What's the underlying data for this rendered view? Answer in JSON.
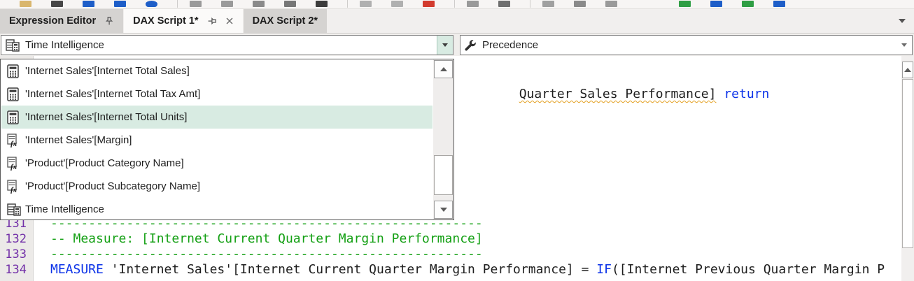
{
  "colors": {
    "keyword-blue": "#0b32e8",
    "comment-green": "#14a014",
    "line-number-purple": "#7230a8",
    "selection-mint": "#d8ebe2",
    "squiggle-orange": "#e3a021",
    "tab-active-bg": "#fbfaf9",
    "tab-inactive-bg": "#d5d3d1"
  },
  "toolbar": {
    "icons": [
      {
        "color": "#d9b66d"
      },
      {
        "color": "#474747"
      },
      {
        "color": "#1e5ec8"
      },
      {
        "color": "#1e5ec8"
      },
      {
        "color": "#1e5ec8",
        "shape": "circle"
      },
      {
        "sep": true
      },
      {
        "color": "#9a9a9a"
      },
      {
        "color": "#9a9a9a"
      },
      {
        "color": "#8a8a8a"
      },
      {
        "color": "#777777"
      },
      {
        "color": "#3c3c3c"
      },
      {
        "sep": true
      },
      {
        "color": "#b0b0b0"
      },
      {
        "color": "#b0b0b0"
      },
      {
        "color": "#d23b2e"
      },
      {
        "sep": true
      },
      {
        "color": "#9a9a9a"
      },
      {
        "color": "#6f6f6f"
      },
      {
        "sep": true
      },
      {
        "color": "#a0a0a0"
      },
      {
        "color": "#8a8a8a"
      },
      {
        "color": "#9a9a9a"
      },
      {
        "gap": 60
      },
      {
        "color": "#2f9e44"
      },
      {
        "color": "#1e5ec8"
      },
      {
        "color": "#2f9e44"
      },
      {
        "color": "#1e5ec8"
      }
    ]
  },
  "tabs": [
    {
      "label": "Expression Editor",
      "state": "inactive",
      "pinned": true
    },
    {
      "label": "DAX Script 1*",
      "state": "active",
      "pinned": false,
      "closable": true
    },
    {
      "label": "DAX Script 2*",
      "state": "inactive"
    }
  ],
  "combos": {
    "left": {
      "value": "Time Intelligence",
      "icon": "calc-table-icon"
    },
    "right": {
      "value": "Precedence",
      "icon": "wrench-icon"
    }
  },
  "dropdown": {
    "items": [
      {
        "label": "'Internet Sales'[Internet Total Sales]",
        "icon": "calculator",
        "selected": false
      },
      {
        "label": "'Internet Sales'[Internet Total Tax Amt]",
        "icon": "calculator",
        "selected": false
      },
      {
        "label": "'Internet Sales'[Internet Total Units]",
        "icon": "calculator",
        "selected": true
      },
      {
        "label": "'Internet Sales'[Margin]",
        "icon": "fx",
        "selected": false
      },
      {
        "label": "'Product'[Product Category Name]",
        "icon": "fx",
        "selected": false
      },
      {
        "label": "'Product'[Product Subcategory Name]",
        "icon": "fx",
        "selected": false
      },
      {
        "label": "Time Intelligence",
        "icon": "calc-table",
        "selected": false
      }
    ]
  },
  "editor": {
    "return_line": {
      "underlined_text": "Quarter Sales Performance]",
      "keyword": "return"
    },
    "lines": [
      {
        "number": "131",
        "segments": [
          {
            "text": "---------------------------------------------------------",
            "style": "comment"
          }
        ]
      },
      {
        "number": "132",
        "segments": [
          {
            "text": "-- Measure: [Internet Current Quarter Margin Performance]",
            "style": "comment"
          }
        ]
      },
      {
        "number": "133",
        "segments": [
          {
            "text": "---------------------------------------------------------",
            "style": "comment"
          }
        ]
      },
      {
        "number": "134",
        "segments": [
          {
            "text": "MEASURE",
            "style": "keyword"
          },
          {
            "text": " 'Internet Sales'[Internet Current Quarter Margin Performance] = ",
            "style": "plain"
          },
          {
            "text": "IF",
            "style": "keyword"
          },
          {
            "text": "([Internet Previous Quarter Margin P",
            "style": "plain"
          }
        ]
      }
    ]
  }
}
